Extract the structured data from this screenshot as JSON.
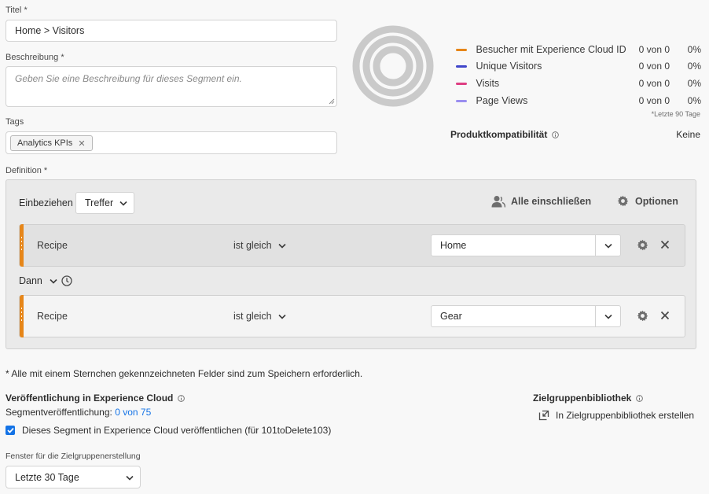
{
  "form": {
    "title_label": "Titel",
    "title_value": "Home > Visitors",
    "description_label": "Beschreibung",
    "description_placeholder": "Geben Sie eine Beschreibung für dieses Segment ein.",
    "tags_label": "Tags",
    "tags": [
      {
        "label": "Analytics KPIs"
      }
    ],
    "definition_label": "Definition",
    "required_marker": "*"
  },
  "summary": {
    "legend": [
      {
        "name": "Besucher mit Experience Cloud ID",
        "count": "0 von 0",
        "pct": "0%",
        "color": "#e68619"
      },
      {
        "name": "Unique Visitors",
        "count": "0 von 0",
        "pct": "0%",
        "color": "#4046ca"
      },
      {
        "name": "Visits",
        "count": "0 von 0",
        "pct": "0%",
        "color": "#de3d82"
      },
      {
        "name": "Page Views",
        "count": "0 von 0",
        "pct": "0%",
        "color": "#9a8ef0"
      }
    ],
    "footnote": "*Letzte 90 Tage",
    "compat_label": "Produktkompatibilität",
    "compat_value": "Keine"
  },
  "definition": {
    "include_label": "Einbeziehen",
    "container_select": "Treffer",
    "include_all_label": "Alle einschließen",
    "options_label": "Optionen",
    "rules": [
      {
        "dimension": "Recipe",
        "operator": "ist gleich",
        "value": "Home"
      },
      {
        "dimension": "Recipe",
        "operator": "ist gleich",
        "value": "Gear"
      }
    ],
    "then_label": "Dann"
  },
  "required_note": "Alle mit einem Sternchen gekennzeichneten Felder sind zum Speichern erforderlich.",
  "publish": {
    "heading": "Veröffentlichung in Experience Cloud",
    "segment_pub_label": "Segmentveröffentlichung:",
    "segment_pub_value": "0 von 75",
    "checkbox_label": "Dieses Segment in Experience Cloud veröffentlichen (für 101toDelete103)",
    "checked": true
  },
  "audience": {
    "heading": "Zielgruppenbibliothek",
    "create_label": "In Zielgruppenbibliothek erstellen"
  },
  "window": {
    "label": "Fenster für die Zielgruppenerstellung",
    "value": "Letzte 30 Tage"
  }
}
